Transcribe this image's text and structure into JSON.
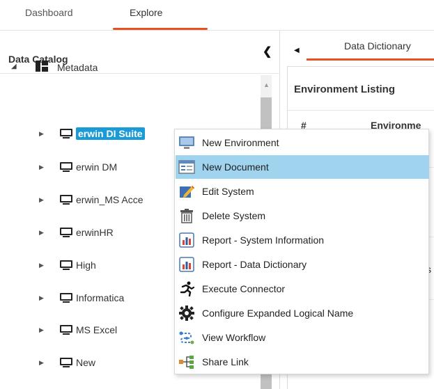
{
  "top_tabs": [
    "Dashboard",
    "Explore"
  ],
  "left_panel": {
    "title": "Data Catalog",
    "collapse_icon": "chevron-left-icon",
    "root": {
      "label": "Metadata",
      "icon": "grid-icon"
    },
    "nodes": [
      {
        "label": "erwin DI Suite",
        "selected": true
      },
      {
        "label": "erwin DM"
      },
      {
        "label": "erwin_MS Acce"
      },
      {
        "label": "erwinHR"
      },
      {
        "label": "High"
      },
      {
        "label": "Informatica"
      },
      {
        "label": "MS Excel"
      },
      {
        "label": "New"
      }
    ]
  },
  "right_panel": {
    "tab_label": "Data Dictionary",
    "section_title": "Environment Listing",
    "columns": [
      "#",
      "Environme"
    ],
    "partial_cell": "s"
  },
  "context_menu": {
    "items": [
      {
        "label": "New Environment",
        "icon": "monitor-new-icon"
      },
      {
        "label": "New Document",
        "icon": "document-icon",
        "hover": true
      },
      {
        "label": "Edit System",
        "icon": "edit-pencil-icon"
      },
      {
        "label": "Delete System",
        "icon": "trash-icon"
      },
      {
        "label": "Report - System Information",
        "icon": "report-chart-icon"
      },
      {
        "label": "Report - Data Dictionary",
        "icon": "report-chart-icon"
      },
      {
        "label": "Execute Connector",
        "icon": "running-person-icon"
      },
      {
        "label": "Configure Expanded Logical Name",
        "icon": "gear-icon"
      },
      {
        "label": "View Workflow",
        "icon": "workflow-icon"
      },
      {
        "label": "Share Link",
        "icon": "share-link-icon"
      }
    ]
  },
  "colors": {
    "accent": "#e8511f",
    "selection": "#1a9bd7",
    "menu_hover": "#9fd3ee"
  }
}
